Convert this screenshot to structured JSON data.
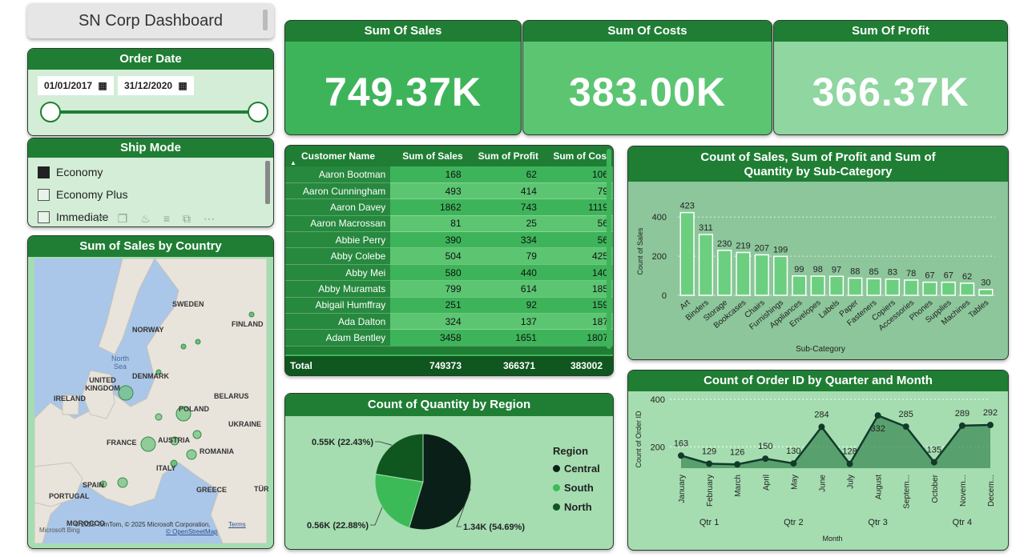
{
  "title": "SN Corp Dashboard",
  "order_date": {
    "title": "Order Date",
    "start": "01/01/2017",
    "end": "31/12/2020"
  },
  "ship_mode": {
    "title": "Ship Mode",
    "items": [
      {
        "label": "Economy",
        "checked": true
      },
      {
        "label": "Economy Plus",
        "checked": false
      },
      {
        "label": "Immediate",
        "checked": false
      }
    ]
  },
  "kpis": {
    "sales": {
      "title": "Sum Of Sales",
      "value": "749.37K"
    },
    "costs": {
      "title": "Sum Of Costs",
      "value": "383.00K"
    },
    "profit": {
      "title": "Sum Of Profit",
      "value": "366.37K"
    }
  },
  "customer_table": {
    "headers": [
      "Customer Name",
      "Sum of Sales",
      "Sum of Profit",
      "Sum of Cost"
    ],
    "rows": [
      [
        "Aaron Bootman",
        "168",
        "62",
        "106"
      ],
      [
        "Aaron Cunningham",
        "493",
        "414",
        "79"
      ],
      [
        "Aaron Davey",
        "1862",
        "743",
        "1119"
      ],
      [
        "Aaron Macrossan",
        "81",
        "25",
        "56"
      ],
      [
        "Abbie Perry",
        "390",
        "334",
        "56"
      ],
      [
        "Abby Colebe",
        "504",
        "79",
        "425"
      ],
      [
        "Abby Mei",
        "580",
        "440",
        "140"
      ],
      [
        "Abby Muramats",
        "799",
        "614",
        "185"
      ],
      [
        "Abigail Humffray",
        "251",
        "92",
        "159"
      ],
      [
        "Ada Dalton",
        "324",
        "137",
        "187"
      ],
      [
        "Adam Bentley",
        "3458",
        "1651",
        "1807"
      ]
    ],
    "total": [
      "Total",
      "749373",
      "366371",
      "383002"
    ]
  },
  "map": {
    "title": "Sum of Sales by Country",
    "labels": [
      "SWEDEN",
      "FINLAND",
      "NORWAY",
      "North Sea",
      "DENMARK",
      "UNITED KINGDOM",
      "IRELAND",
      "BELARUS",
      "POLAND",
      "UKRAINE",
      "FRANCE",
      "AUSTRIA",
      "ROMANIA",
      "ITALY",
      "SPAIN",
      "PORTUGAL",
      "GREECE",
      "TÜR",
      "MOROCCO"
    ],
    "attribution": "© 2025 TomTom, © 2025 Microsoft Corporation,",
    "terms": "Terms",
    "osm": "© OpenStreetMap",
    "bing": "Microsoft Bing"
  },
  "chart_data": [
    {
      "type": "bar",
      "title": "Count of Sales, Sum of Profit and Sum of Quantity by Sub-Category",
      "xlabel": "Sub-Category",
      "ylabel": "Count of Sales",
      "ylim": [
        0,
        450
      ],
      "yticks": [
        0,
        200,
        400
      ],
      "categories": [
        "Art",
        "Binders",
        "Storage",
        "Bookcases",
        "Chairs",
        "Furnishings",
        "Appliances",
        "Envelopes",
        "Labels",
        "Paper",
        "Fasteners",
        "Copiers",
        "Accessories",
        "Phones",
        "Supplies",
        "Machines",
        "Tables"
      ],
      "values": [
        423,
        311,
        230,
        219,
        207,
        199,
        99,
        98,
        97,
        88,
        85,
        83,
        78,
        67,
        67,
        62,
        30
      ]
    },
    {
      "type": "area",
      "title": "Count of Order ID by Quarter and Month",
      "xlabel": "Month",
      "ylabel": "Count of Order ID",
      "yticks": [
        200,
        400
      ],
      "categories": [
        "January",
        "February",
        "March",
        "April",
        "May",
        "June",
        "July",
        "August",
        "Septem...",
        "October",
        "Novem...",
        "Decem..."
      ],
      "quarters": [
        "Qtr 1",
        "Qtr 2",
        "Qtr 3",
        "Qtr 4"
      ],
      "values": [
        163,
        129,
        126,
        150,
        130,
        284,
        128,
        332,
        285,
        135,
        289,
        292
      ]
    },
    {
      "type": "pie",
      "title": "Count of Quantity by Region",
      "legend_title": "Region",
      "labels": [
        "Central",
        "South",
        "North"
      ],
      "values": [
        1.34,
        0.56,
        0.55
      ],
      "data_labels": [
        "1.34K (54.69%)",
        "0.56K (22.88%)",
        "0.55K (22.43%)"
      ],
      "colors": [
        "#0a1f17",
        "#3dba58",
        "#10561f"
      ]
    }
  ]
}
